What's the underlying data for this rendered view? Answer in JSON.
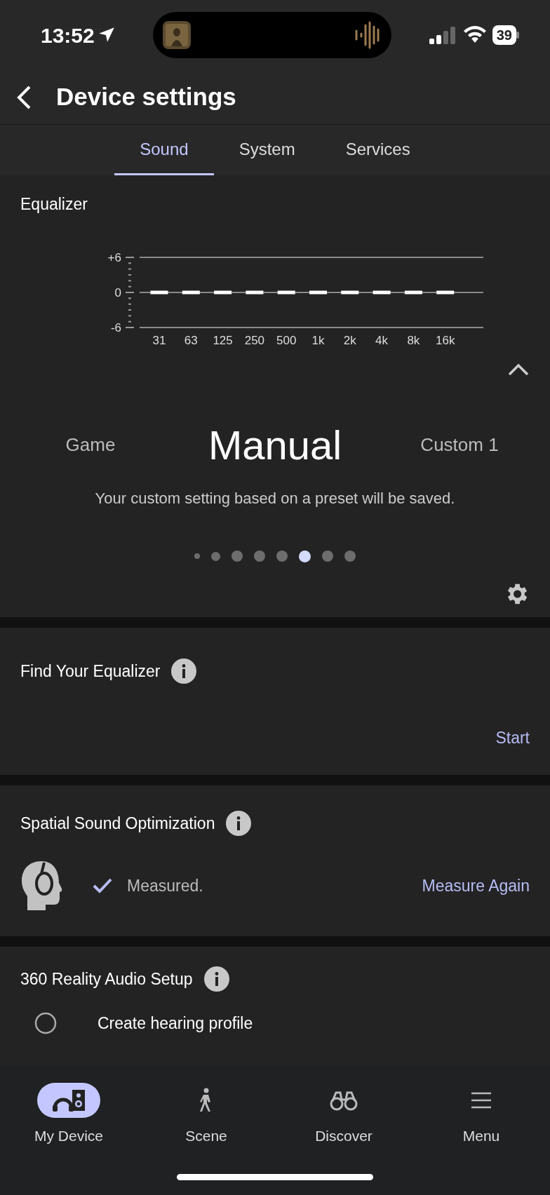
{
  "status_bar": {
    "time": "13:52",
    "battery": "39"
  },
  "header": {
    "title": "Device settings"
  },
  "tabs": [
    {
      "label": "Sound",
      "selected": true
    },
    {
      "label": "System",
      "selected": false
    },
    {
      "label": "Services",
      "selected": false
    }
  ],
  "equalizer": {
    "title": "Equalizer",
    "chart_data": {
      "type": "bar",
      "categories": [
        "31",
        "63",
        "125",
        "250",
        "500",
        "1k",
        "2k",
        "4k",
        "8k",
        "16k"
      ],
      "values": [
        0,
        0,
        0,
        0,
        0,
        0,
        0,
        0,
        0,
        0
      ],
      "ylim": [
        -6,
        6
      ],
      "yticks": [
        {
          "value": 6,
          "label": "+6"
        },
        0,
        -6
      ]
    },
    "expanded": true,
    "presets": [
      {
        "label": "Game",
        "selected": false
      },
      {
        "label": "Manual",
        "selected": true
      },
      {
        "label": "Custom 1",
        "selected": false
      }
    ],
    "description": "Your custom setting based on a preset will be saved.",
    "pages": [
      {
        "selected": false
      },
      {
        "selected": false
      },
      {
        "selected": false
      },
      {
        "selected": false
      },
      {
        "selected": false
      },
      {
        "selected": true
      },
      {
        "selected": false
      },
      {
        "selected": false
      }
    ]
  },
  "find_equalizer": {
    "title": "Find Your Equalizer",
    "action": "Start"
  },
  "spatial": {
    "title": "Spatial Sound Optimization",
    "status": "Measured.",
    "measured": true,
    "action": "Measure Again"
  },
  "reality_audio": {
    "title": "360 Reality Audio Setup",
    "steps": [
      {
        "label": "Create hearing profile"
      }
    ]
  },
  "nav": [
    {
      "label": "My Device",
      "kind": "device",
      "selected": true
    },
    {
      "label": "Scene",
      "kind": "scene",
      "selected": false
    },
    {
      "label": "Discover",
      "kind": "discover",
      "selected": false
    },
    {
      "label": "Menu",
      "kind": "menu",
      "selected": false
    }
  ]
}
